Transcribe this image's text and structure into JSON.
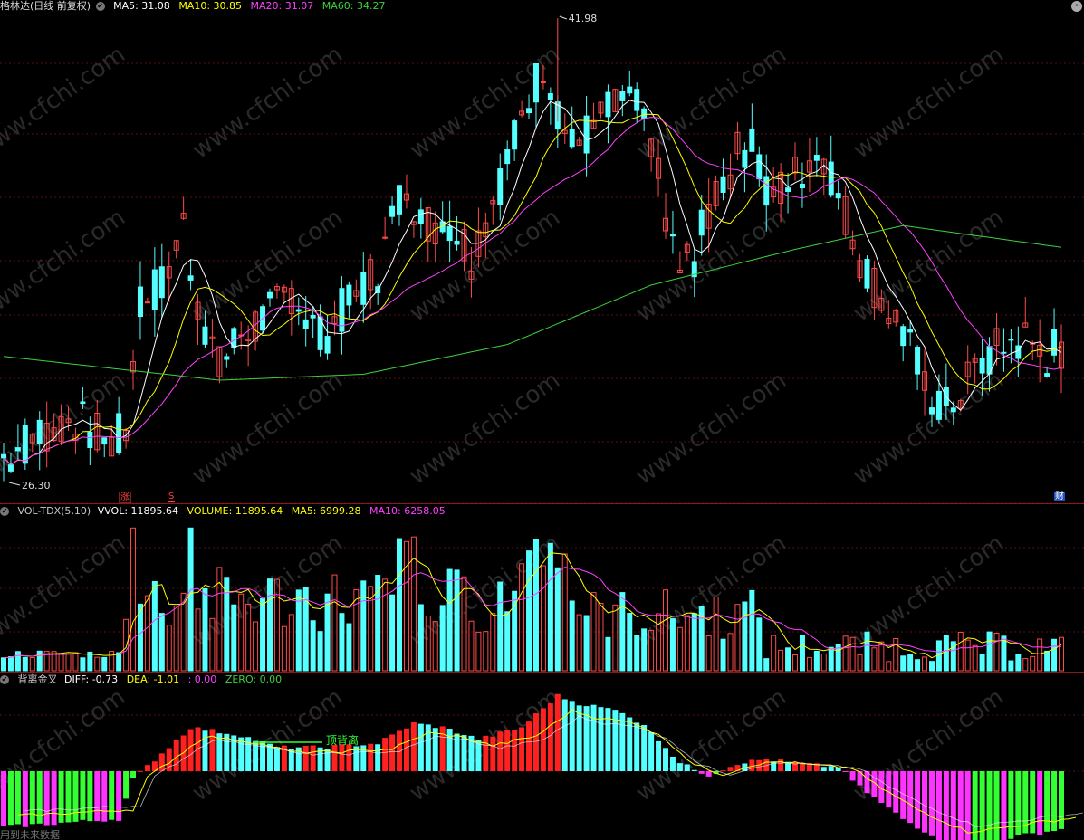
{
  "header": {
    "stock": "格林达(日线 前复权)",
    "ma5": "MA5: 31.08",
    "ma10": "MA10: 30.85",
    "ma20": "MA20: 31.07",
    "ma60": "MA60: 34.27"
  },
  "price": {
    "high_label": "41.98",
    "low_label": "26.30",
    "high": 41.98,
    "low": 26.3
  },
  "markers": {
    "zhang": "涨",
    "s": "S",
    "cai": "财"
  },
  "volume_header": {
    "title": "VOL-TDX(5,10)",
    "vvol": "VVOL: 11895.64",
    "volume": "VOLUME: 11895.64",
    "ma5": "MA5: 6999.28",
    "ma10": "MA10: 6258.05"
  },
  "macd_header": {
    "title": "背离金叉",
    "diff": "DIFF: -0.73",
    "dea": "DEA: -1.01",
    "blank": ": 0.00",
    "zero": "ZERO: 0.00"
  },
  "annotation": "顶背离",
  "footer": "用到未来数据",
  "watermark": "www.cfchi.com",
  "colors": {
    "up": "#ff4a4a",
    "down": "#54ffff",
    "ma5": "#ffffff",
    "ma10": "#ffff00",
    "ma20": "#ff40ff",
    "ma60": "#3cd23c",
    "macd_green": "#33ff33",
    "macd_magenta": "#ff33ff"
  }
}
